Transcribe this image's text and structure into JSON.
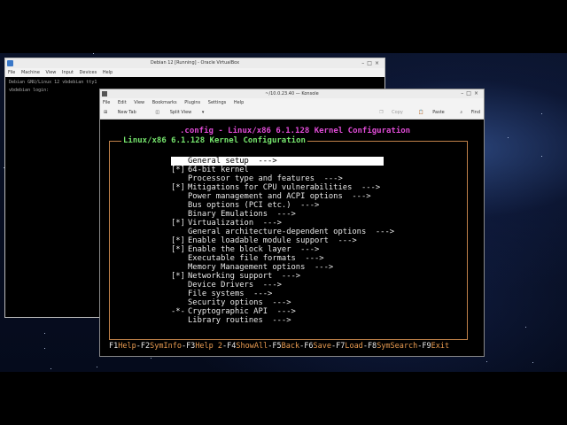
{
  "virtualbox": {
    "title": "Debian 12 [Running] - Oracle VirtualBox",
    "menu": [
      "File",
      "Machine",
      "View",
      "Input",
      "Devices",
      "Help"
    ],
    "console_lines": [
      "Debian GNU/Linux 12 vbdebian tty1",
      "",
      "vbdebian login:"
    ]
  },
  "konsole": {
    "title": "~/10.0.23.40 — Konsole",
    "menu": [
      "File",
      "Edit",
      "View",
      "Bookmarks",
      "Plugins",
      "Settings",
      "Help"
    ],
    "toolbar": {
      "new_tab": "New Tab",
      "split_view": "Split View",
      "copy": "Copy",
      "paste": "Paste",
      "find": "Find"
    }
  },
  "menuconfig": {
    "window_title": ".config - Linux/x86 6.1.128 Kernel Configuration",
    "box_title": "Linux/x86 6.1.128 Kernel Configuration",
    "items": [
      {
        "prefix": "",
        "label": "General setup  --->",
        "selected": true
      },
      {
        "prefix": "[*]",
        "label": "64-bit kernel"
      },
      {
        "prefix": "",
        "label": "Processor type and features  --->"
      },
      {
        "prefix": "[*]",
        "label": "Mitigations for CPU vulnerabilities  --->"
      },
      {
        "prefix": "",
        "label": "Power management and ACPI options  --->"
      },
      {
        "prefix": "",
        "label": "Bus options (PCI etc.)  --->"
      },
      {
        "prefix": "",
        "label": "Binary Emulations  --->"
      },
      {
        "prefix": "[*]",
        "label": "Virtualization  --->"
      },
      {
        "prefix": "",
        "label": "General architecture-dependent options  --->"
      },
      {
        "prefix": "[*]",
        "label": "Enable loadable module support  --->"
      },
      {
        "prefix": "[*]",
        "label": "Enable the block layer  --->"
      },
      {
        "prefix": "",
        "label": "Executable file formats  --->"
      },
      {
        "prefix": "",
        "label": "Memory Management options  --->"
      },
      {
        "prefix": "[*]",
        "label": "Networking support  --->"
      },
      {
        "prefix": "",
        "label": "Device Drivers  --->"
      },
      {
        "prefix": "",
        "label": "File systems  --->"
      },
      {
        "prefix": "",
        "label": "Security options  --->"
      },
      {
        "prefix": "-*-",
        "label": "Cryptographic API  --->"
      },
      {
        "prefix": "",
        "label": "Library routines  --->"
      }
    ],
    "function_keys": [
      {
        "key": "F1",
        "label": "Help"
      },
      {
        "key": "F2",
        "label": "SymInfo"
      },
      {
        "key": "F3",
        "label": "Help 2"
      },
      {
        "key": "F4",
        "label": "ShowAll"
      },
      {
        "key": "F5",
        "label": "Back"
      },
      {
        "key": "F6",
        "label": "Save"
      },
      {
        "key": "F7",
        "label": "Load"
      },
      {
        "key": "F8",
        "label": "SymSearch"
      },
      {
        "key": "F9",
        "label": "Exit"
      }
    ]
  },
  "colors": {
    "title_magenta": "#e04bd6",
    "head_green": "#76e66d",
    "border_orange": "#c0824a",
    "fkey_label": "#e79a50"
  }
}
